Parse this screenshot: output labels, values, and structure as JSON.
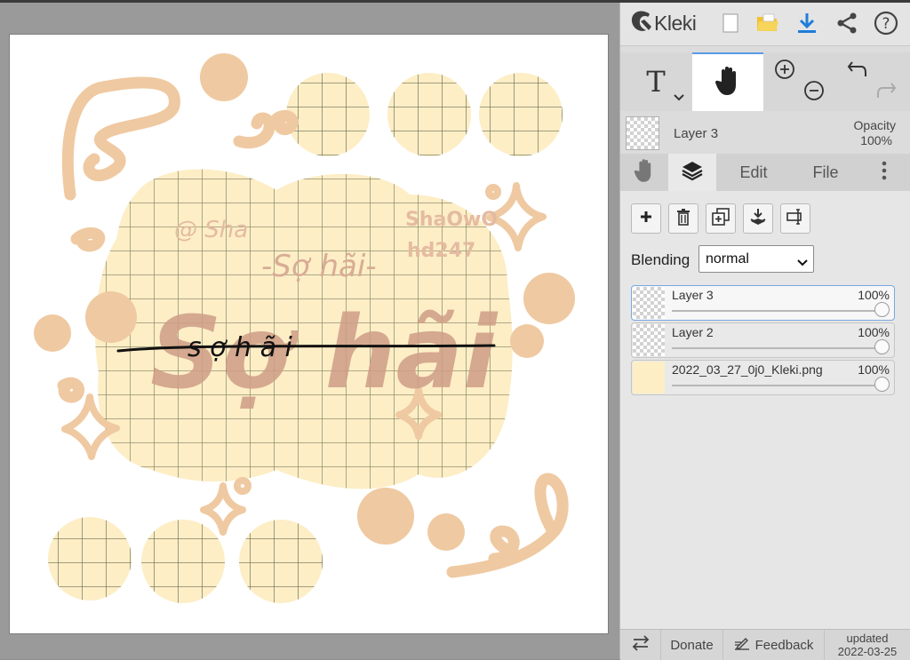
{
  "app": {
    "name": "Kleki"
  },
  "toolbar": {
    "icons": [
      "new-image-icon",
      "open-folder-icon",
      "download-icon",
      "share-icon",
      "help-icon"
    ],
    "tools": [
      "text-tool-icon",
      "hand-tool-icon",
      "zoom-in-icon",
      "zoom-out-icon",
      "undo-icon",
      "redo-icon"
    ],
    "text_tool_label": "T",
    "accent_color": "#1f7ed8",
    "folder_color": "#f2c230"
  },
  "current_layer": {
    "name": "Layer 3",
    "opacity_label": "Opacity",
    "opacity_value": "100%"
  },
  "tabs": {
    "edit": "Edit",
    "file": "File"
  },
  "layer_tools": [
    "add-layer-icon",
    "delete-layer-icon",
    "duplicate-layer-icon",
    "merge-down-icon",
    "rename-layer-icon"
  ],
  "blending": {
    "label": "Blending",
    "value": "normal"
  },
  "layers": [
    {
      "name": "Layer 3",
      "opacity": "100%"
    },
    {
      "name": "Layer 2",
      "opacity": "100%"
    },
    {
      "name": "2022_03_27_0j0_Kleki.png",
      "opacity": "100%"
    }
  ],
  "footer": {
    "donate": "Donate",
    "feedback": "Feedback",
    "updated_label": "updated",
    "updated_date": "2022-03-25"
  },
  "artwork": {
    "handle_1": "@ Sha",
    "handle_2": "ShaOwO",
    "handle_3": "hd247",
    "title_small": "-Sợ hãi-",
    "title_large": "Sợ hãi",
    "script_text": "s ợ h ã i",
    "palette": {
      "cream": "#fdeec6",
      "peach": "#efc9a1",
      "brown": "#cf9e86",
      "grid": "#6b6b4f"
    }
  }
}
